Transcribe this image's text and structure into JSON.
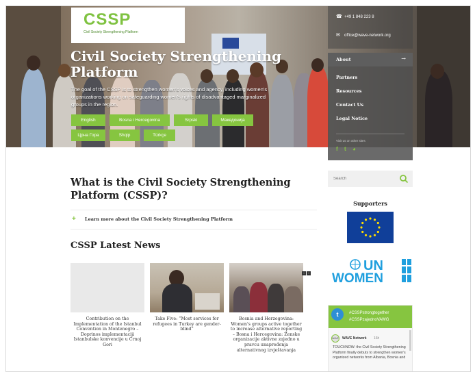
{
  "header": {
    "logo_text": "CSSP",
    "logo_tagline": "Civil Society Strengthening Platform",
    "hero_title": "Civil Society Strengthening Platform",
    "hero_description": "The goal of the CSSP is to strengthen women's voices and agency, including women's organizations working on safeguarding women's rights of disadvantaged marginalized groups in the region."
  },
  "language_buttons": [
    "English",
    "Bosna i Hercegovina",
    "Srpski",
    "Македонија",
    "Црна Гора",
    "Shqip",
    "Türkçe"
  ],
  "contact": {
    "phone": "+49 1 848 223 8",
    "email": "office@wave-network.org"
  },
  "menu": {
    "items": [
      "About",
      "Partners",
      "Resources",
      "Contact Us",
      "Legal Notice"
    ],
    "follow_label": "Visit us on other sites",
    "social": [
      "f",
      "t",
      "rss"
    ]
  },
  "main": {
    "heading": "What is the Civil Society Strengthening Platform (CSSP)?",
    "learn_more": "Learn more about the Civil Society Strengthening Platform",
    "news_heading": "CSSP Latest News",
    "news": [
      {
        "caption": "Contribution on the Implementation of the Istanbul Convention in Montenegro – Doprinos implementaciji Istanbulske konvencije u Crnoj Gori"
      },
      {
        "caption": "Take Five: “Most services for refugees in Turkey are gender-blind”"
      },
      {
        "caption": "Bosnia and Herzegovina: Women's groups active together to increase alternative reporting – Bosna i Hercegovina: Ženske organizacije aktivne zajedno u pravcu unapređenja alternativnog izvještavanja"
      }
    ]
  },
  "sidebar": {
    "search_placeholder": "Search",
    "supporters_heading": "Supporters",
    "un_women_text": "UN WOMEN",
    "twitter": {
      "hashtag1": "#CSSPstrongtogether",
      "hashtag2": "#CSSPzajednoVAWG",
      "author": "WAVE Network",
      "handle": "16h",
      "text": "TOUCHNOW: the Civil Society Strengthening Platform finally debuts to strengthen women's organized networks from Albania, Bosnia and"
    }
  },
  "colors": {
    "accent": "#86c540",
    "eu_blue": "#103f99",
    "un_blue": "#1f9fde",
    "dark_panel": "#505050"
  }
}
